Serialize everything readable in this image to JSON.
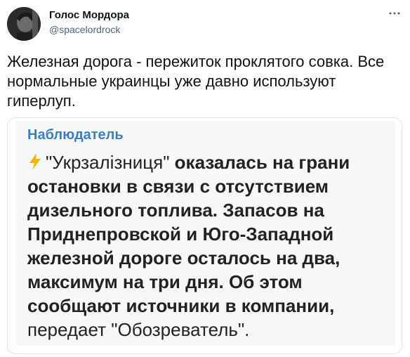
{
  "author": {
    "name": "Голос Мордора",
    "handle": "@spacelordrock"
  },
  "tweet": {
    "text": "Железная дорога - пережиток проклятого совка. Все нормальные украинцы уже давно используют гиперлуп."
  },
  "quote": {
    "channel": "Наблюдатель",
    "company": "\"Укрзалізниця\"",
    "body_bold": " оказалась на грани остановки в связи с отсутствием дизельного топлива. Запасов на Приднепровской и Юго-Западной железной дороге осталось на два, максимум на три дня. Об этом сообщают источники в компании,",
    "body_tail": " передает \"Обозреватель\"."
  },
  "icons": {
    "more": "more-dots-icon",
    "bolt": "lightning-icon"
  },
  "colors": {
    "channel": "#3b7ec4",
    "handle": "#536471",
    "bolt": "#f5b400"
  }
}
